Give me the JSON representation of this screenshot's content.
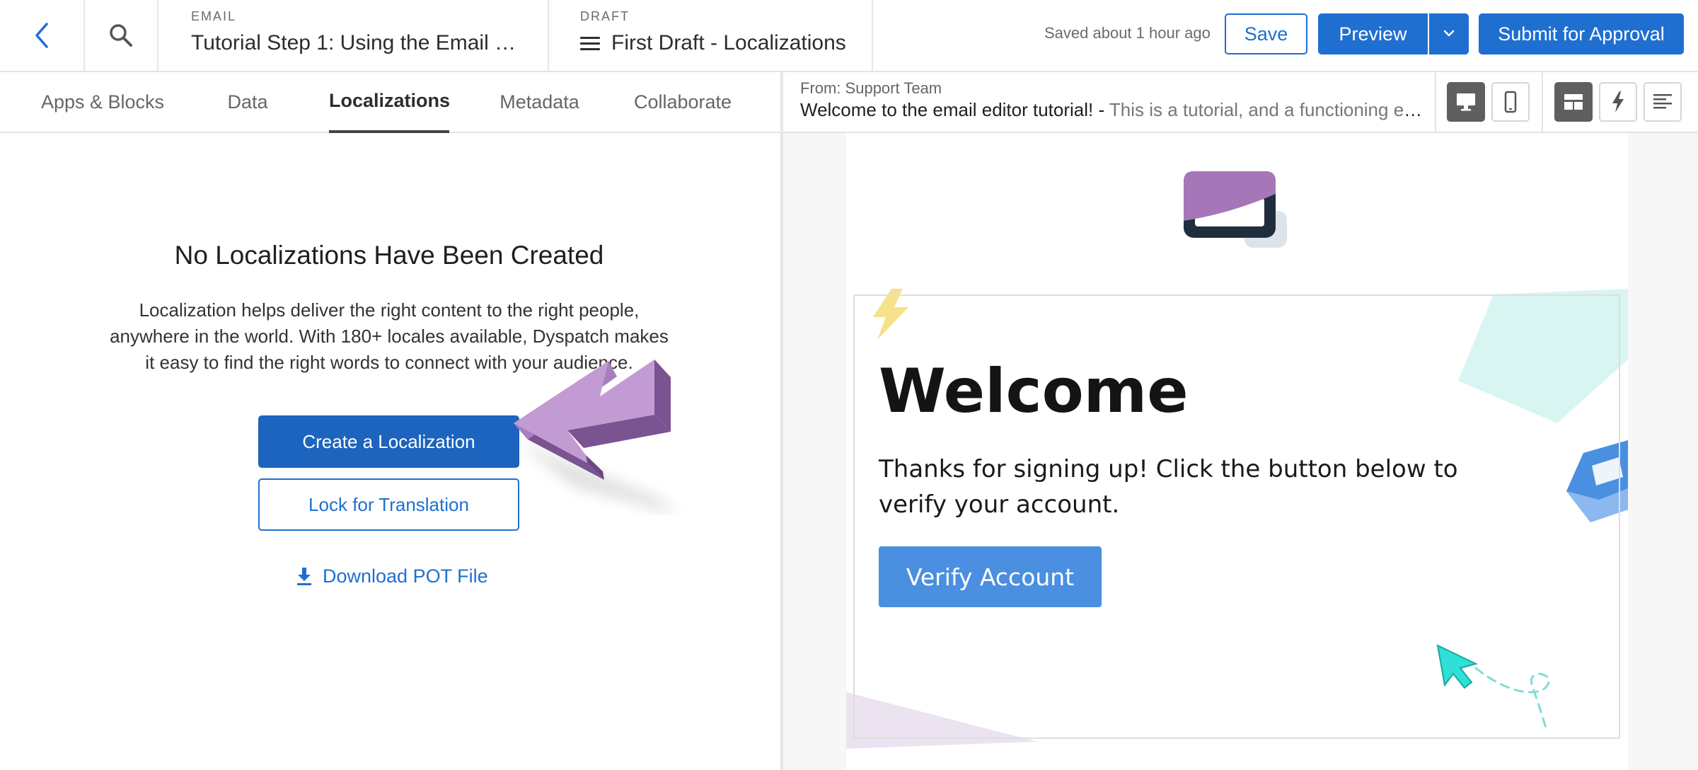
{
  "header": {
    "email_label": "EMAIL",
    "email_title": "Tutorial Step 1: Using the Email B...",
    "draft_label": "DRAFT",
    "draft_title": "First Draft - Localizations",
    "saved_status": "Saved about 1 hour ago",
    "save_label": "Save",
    "preview_label": "Preview",
    "submit_label": "Submit for Approval"
  },
  "tabs": [
    {
      "label": "Apps & Blocks"
    },
    {
      "label": "Data"
    },
    {
      "label": "Localizations"
    },
    {
      "label": "Metadata"
    },
    {
      "label": "Collaborate"
    }
  ],
  "localizations": {
    "title": "No Localizations Have Been Created",
    "description": "Localization helps deliver the right content to the right people, anywhere in the world. With 180+ locales available, Dyspatch makes it easy to find the right words to connect with your audience.",
    "create_label": "Create a Localization",
    "lock_label": "Lock for Translation",
    "download_label": "Download POT File"
  },
  "preview": {
    "from": "From: Support Team",
    "subject": "Welcome to the email editor tutorial! -",
    "preheader": "This is a tutorial, and a functioning em..."
  },
  "email": {
    "heading": "Welcome",
    "body": "Thanks for signing up! Click the button below to verify your account.",
    "button_label": "Verify Account"
  },
  "icons": {
    "back": "chevron-left-icon",
    "search": "search-icon",
    "menu": "hamburger-icon",
    "dropdown": "chevron-down-icon",
    "download": "download-icon",
    "desktop": "desktop-icon",
    "mobile": "mobile-icon",
    "layout": "layout-icon",
    "amp": "lightning-icon",
    "text": "text-align-icon"
  },
  "colors": {
    "primary": "#1f6fd1",
    "create_button": "#1c64be",
    "verify_button": "#4a8fe0",
    "arrow_purple": "#c39bd3",
    "active_toggle": "#5f5f5f"
  }
}
